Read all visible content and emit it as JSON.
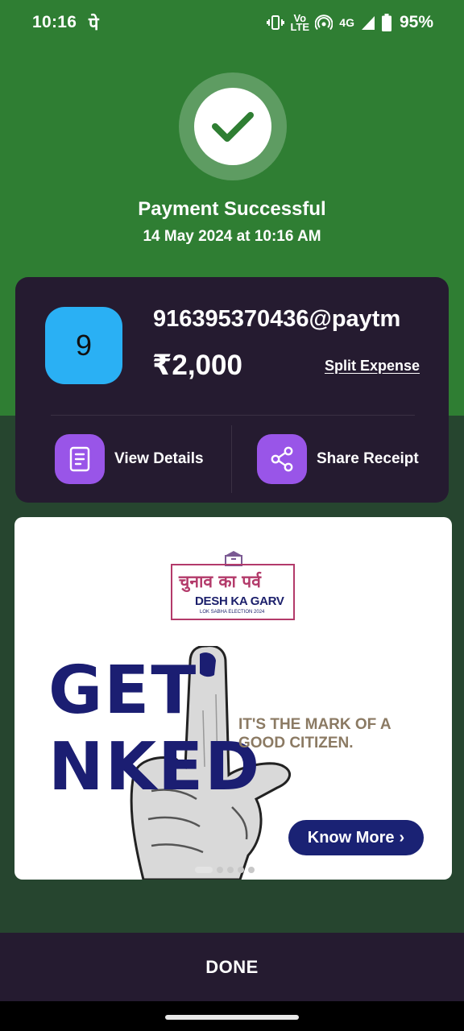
{
  "status_bar": {
    "time": "10:16",
    "carrier_glyph": "पे",
    "volte_label": "Vo LTE",
    "network": "4G",
    "battery": "95%"
  },
  "success": {
    "title": "Payment Successful",
    "datetime": "14 May 2024 at 10:16 AM"
  },
  "card": {
    "avatar_initial": "9",
    "upi_id": "916395370436@paytm",
    "amount": "₹2,000",
    "split_label": "Split Expense",
    "actions": {
      "view_details": "View Details",
      "share_receipt": "Share Receipt"
    }
  },
  "banner": {
    "logo_hindi": "चुनाव का पर्व",
    "logo_english": "DESH KA GARV",
    "logo_small": "LOK SABHA ELECTION 2024",
    "headline_left": "GET",
    "headline_right": "NKED",
    "tagline_line1": "IT'S THE MARK OF A",
    "tagline_line2": "GOOD CITIZEN.",
    "cta": "Know More",
    "cta_chevron": "›"
  },
  "done_label": "DONE",
  "colors": {
    "header_green": "#2f7e33",
    "lower_green": "#26452f",
    "card_bg": "#251b30",
    "avatar_blue": "#2ab0f4",
    "action_purple": "#9955e8",
    "banner_navy": "#1b1e72"
  }
}
